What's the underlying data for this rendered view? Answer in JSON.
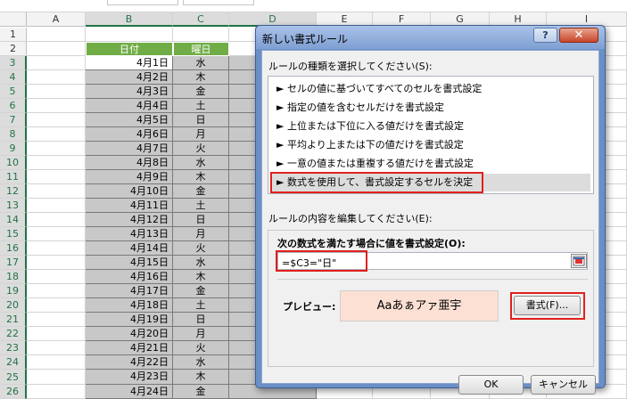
{
  "columns": [
    "A",
    "B",
    "C",
    "D",
    "E",
    "F",
    "G",
    "H",
    "I"
  ],
  "header_row": {
    "date": "日付",
    "day": "曜日"
  },
  "rows": [
    {
      "num": "1",
      "date": "",
      "day": ""
    },
    {
      "num": "2",
      "date": "",
      "day": ""
    },
    {
      "num": "3",
      "date": "4月1日",
      "day": "水"
    },
    {
      "num": "4",
      "date": "4月2日",
      "day": "木"
    },
    {
      "num": "5",
      "date": "4月3日",
      "day": "金"
    },
    {
      "num": "6",
      "date": "4月4日",
      "day": "土"
    },
    {
      "num": "7",
      "date": "4月5日",
      "day": "日"
    },
    {
      "num": "8",
      "date": "4月6日",
      "day": "月"
    },
    {
      "num": "9",
      "date": "4月7日",
      "day": "火"
    },
    {
      "num": "10",
      "date": "4月8日",
      "day": "水"
    },
    {
      "num": "11",
      "date": "4月9日",
      "day": "木"
    },
    {
      "num": "12",
      "date": "4月10日",
      "day": "金"
    },
    {
      "num": "13",
      "date": "4月11日",
      "day": "土"
    },
    {
      "num": "14",
      "date": "4月12日",
      "day": "日"
    },
    {
      "num": "15",
      "date": "4月13日",
      "day": "月"
    },
    {
      "num": "16",
      "date": "4月14日",
      "day": "火"
    },
    {
      "num": "17",
      "date": "4月15日",
      "day": "水"
    },
    {
      "num": "18",
      "date": "4月16日",
      "day": "木"
    },
    {
      "num": "19",
      "date": "4月17日",
      "day": "金"
    },
    {
      "num": "20",
      "date": "4月18日",
      "day": "土"
    },
    {
      "num": "21",
      "date": "4月19日",
      "day": "日"
    },
    {
      "num": "22",
      "date": "4月20日",
      "day": "月"
    },
    {
      "num": "23",
      "date": "4月21日",
      "day": "火"
    },
    {
      "num": "24",
      "date": "4月22日",
      "day": "水"
    },
    {
      "num": "25",
      "date": "4月23日",
      "day": "木"
    },
    {
      "num": "26",
      "date": "4月24日",
      "day": "金"
    }
  ],
  "dialog": {
    "title": "新しい書式ルール",
    "help_label": "?",
    "close_label": "✕",
    "rule_type_label": "ルールの種類を選択してください(S):",
    "rule_types": [
      "► セルの値に基づいてすべてのセルを書式設定",
      "► 指定の値を含むセルだけを書式設定",
      "► 上位または下位に入る値だけを書式設定",
      "► 平均より上または下の値だけを書式設定",
      "► 一意の値または重複する値だけを書式設定",
      "► 数式を使用して、書式設定するセルを決定"
    ],
    "selected_rule_index": 5,
    "edit_label": "ルールの内容を編集してください(E):",
    "formula_label": "次の数式を満たす場合に値を書式設定(O):",
    "formula_value": "=$C3=\"日\"",
    "preview_label": "プレビュー:",
    "preview_text": "Aaあぁアァ亜宇",
    "format_button": "書式(F)...",
    "ok_button": "OK",
    "cancel_button": "キャンセル"
  },
  "colors": {
    "header_green": "#70ad47",
    "highlight_red": "#e0201c",
    "preview_fill": "#fbe0d3"
  }
}
